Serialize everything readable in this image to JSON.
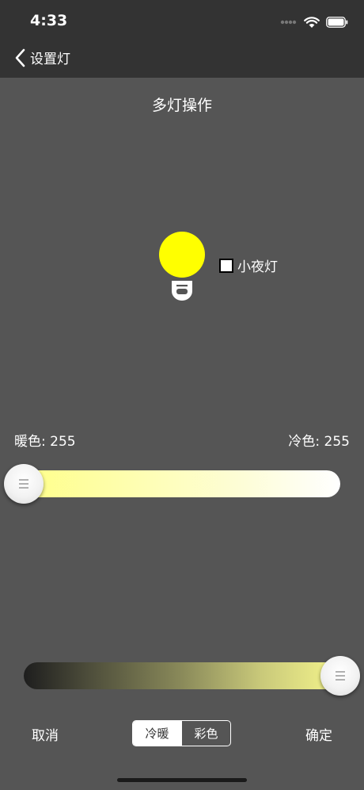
{
  "status_bar": {
    "time": "4:33"
  },
  "nav": {
    "back_label": "设置灯"
  },
  "page": {
    "title": "多灯操作"
  },
  "bulb": {
    "color": "#ffff00"
  },
  "night_light": {
    "label": "小夜灯",
    "checked": false
  },
  "temperature": {
    "warm_label": "暖色: 255",
    "cold_label": "冷色: 255",
    "slider_fraction": 0.0
  },
  "brightness": {
    "slider_fraction": 1.0
  },
  "footer": {
    "cancel_label": "取消",
    "confirm_label": "确定",
    "modes": [
      "冷暖",
      "彩色"
    ],
    "selected_mode": "冷暖"
  }
}
